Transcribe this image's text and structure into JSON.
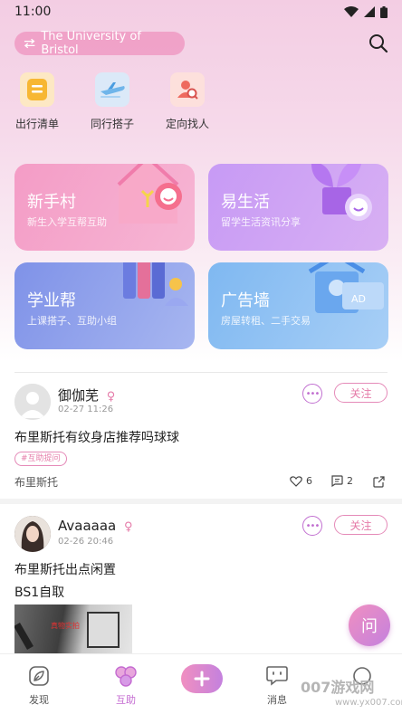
{
  "status_bar": {
    "time": "11:00"
  },
  "header": {
    "university": "The University of Bristol"
  },
  "quick_links": [
    {
      "label": "出行清单",
      "icon": "list-icon"
    },
    {
      "label": "同行搭子",
      "icon": "airplane-icon"
    },
    {
      "label": "定向找人",
      "icon": "person-search-icon"
    }
  ],
  "cards": [
    {
      "title": "新手村",
      "subtitle": "新生入学互帮互助",
      "icon": "house-icon"
    },
    {
      "title": "易生活",
      "subtitle": "留学生活资讯分享",
      "icon": "plant-icon"
    },
    {
      "title": "学业帮",
      "subtitle": "上课搭子、互助小组",
      "icon": "books-icon"
    },
    {
      "title": "广告墙",
      "subtitle": "房屋转租、二手交易",
      "icon": "billboard-icon",
      "badge": "AD"
    }
  ],
  "posts": [
    {
      "author": "御伽芜",
      "gender": "♀",
      "time": "02-27 11:26",
      "text": "布里斯托有纹身店推荐吗球球",
      "tag": "#互助提问",
      "location": "布里斯托",
      "likes": "6",
      "comments": "2",
      "follow_label": "关注"
    },
    {
      "author": "Avaaaaa",
      "gender": "♀",
      "time": "02-26 20:46",
      "text": "布里斯托出点闲置",
      "text2": "BS1自取",
      "image_caption": "真物实拍",
      "follow_label": "关注"
    }
  ],
  "fab": {
    "label": "问"
  },
  "tabbar": {
    "tabs": [
      {
        "label": "发现",
        "icon": "leaf-icon"
      },
      {
        "label": "互助",
        "icon": "help-bubbles-icon",
        "active": true
      },
      {
        "label": "消息",
        "icon": "message-icon"
      }
    ]
  },
  "watermark": {
    "main": "007游戏网",
    "sub": "www.yx007.com"
  },
  "colors": {
    "accent": "#c46bd1",
    "pink": "#e57aa8"
  }
}
